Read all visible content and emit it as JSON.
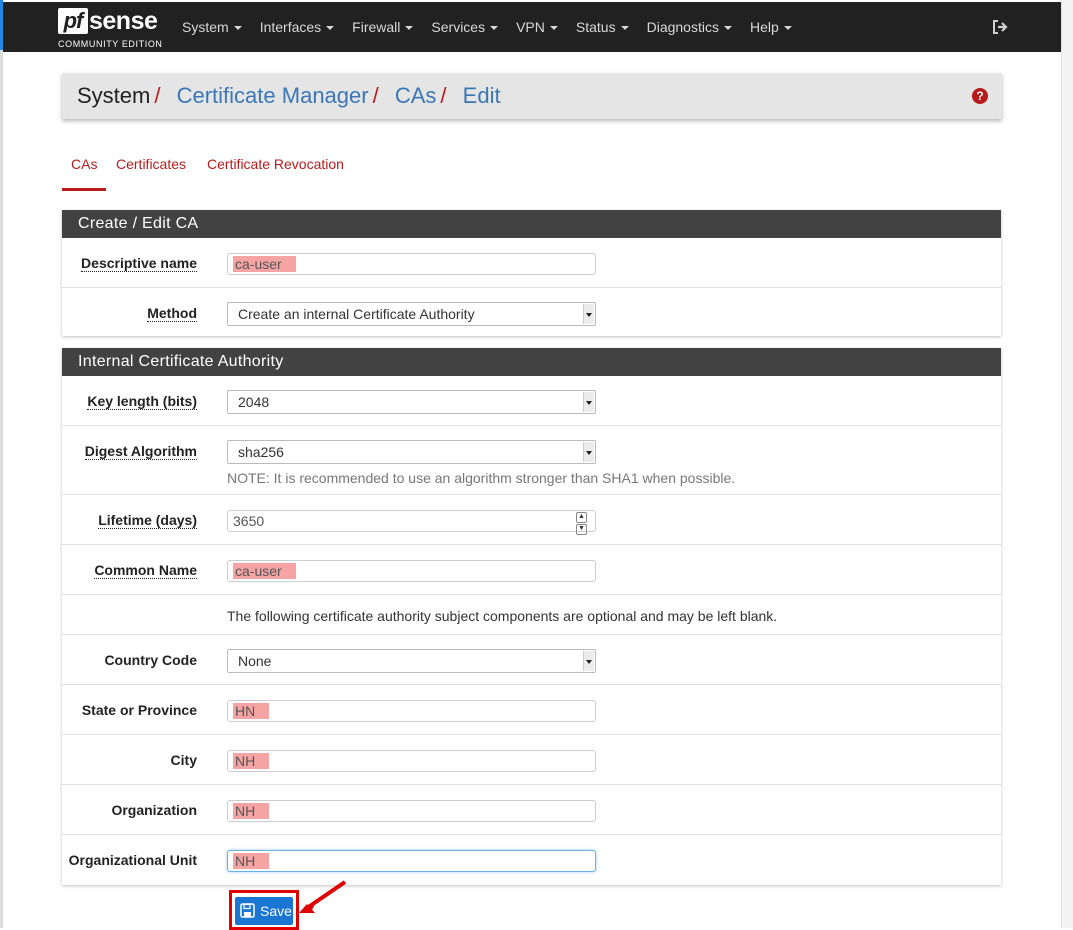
{
  "colors": {
    "navbar": "#212121",
    "accent_red": "#b71c1c",
    "link_blue": "#3a78b5",
    "panel_heading": "#424242",
    "save_blue": "#1976d2",
    "highlight": "#f5a3a3"
  },
  "navbar": {
    "logo": {
      "pf": "pf",
      "sense": "sense",
      "edition": "COMMUNITY EDITION"
    },
    "menu": [
      "System",
      "Interfaces",
      "Firewall",
      "Services",
      "VPN",
      "Status",
      "Diagnostics",
      "Help"
    ],
    "logout_icon": "sign-out-icon"
  },
  "breadcrumb": {
    "root": "System",
    "items": [
      "Certificate Manager",
      "CAs",
      "Edit"
    ],
    "separator": "/"
  },
  "tabs": [
    {
      "label": "CAs",
      "active": true
    },
    {
      "label": "Certificates",
      "active": false
    },
    {
      "label": "Certificate Revocation",
      "active": false
    }
  ],
  "panel_create": {
    "heading": "Create / Edit CA",
    "descriptive_name": {
      "label": "Descriptive name",
      "value": "ca-user"
    },
    "method": {
      "label": "Method",
      "value": "Create an internal Certificate Authority"
    }
  },
  "panel_internal": {
    "heading": "Internal Certificate Authority",
    "key_length": {
      "label": "Key length (bits)",
      "value": "2048"
    },
    "digest": {
      "label": "Digest Algorithm",
      "value": "sha256",
      "note": "NOTE: It is recommended to use an algorithm stronger than SHA1 when possible."
    },
    "lifetime": {
      "label": "Lifetime (days)",
      "value": "3650"
    },
    "common_name": {
      "label": "Common Name",
      "value": "ca-user"
    },
    "optional_note": "The following certificate authority subject components are optional and may be left blank.",
    "country": {
      "label": "Country Code",
      "value": "None"
    },
    "state": {
      "label": "State or Province",
      "value": "HN"
    },
    "city": {
      "label": "City",
      "value": "NH"
    },
    "organization": {
      "label": "Organization",
      "value": "NH"
    },
    "org_unit": {
      "label": "Organizational Unit",
      "value": "NH"
    }
  },
  "save": {
    "label": "Save"
  }
}
